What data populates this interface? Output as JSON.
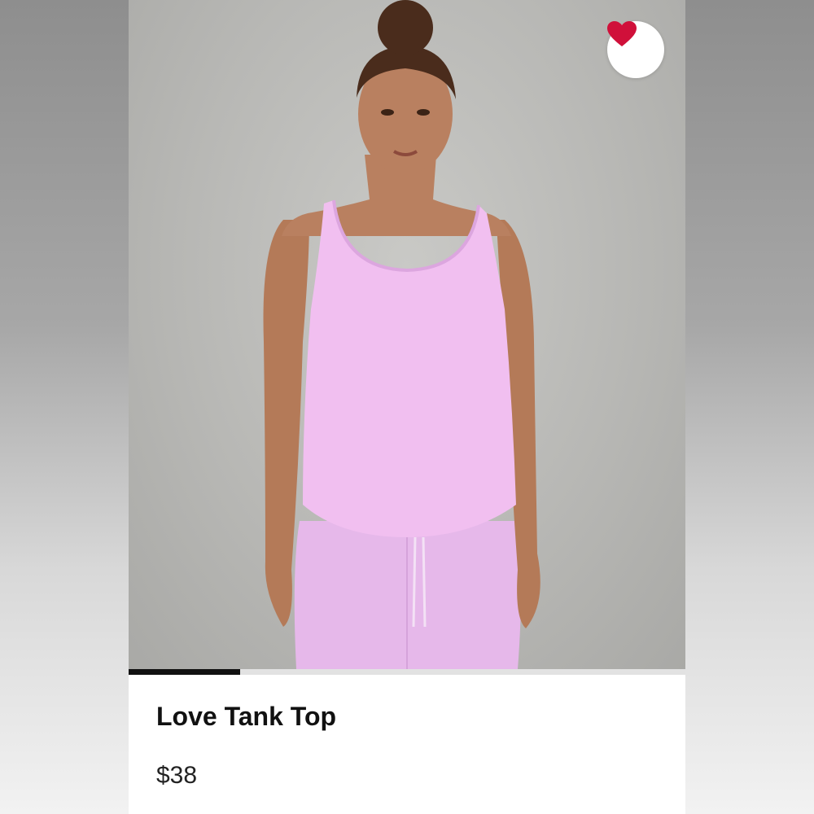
{
  "product": {
    "title": "Love Tank Top",
    "price": "$38",
    "favorite_icon": "heart-icon",
    "favorited": true,
    "accent_color": "#d0103a"
  },
  "gallery": {
    "progress": 0.2
  }
}
